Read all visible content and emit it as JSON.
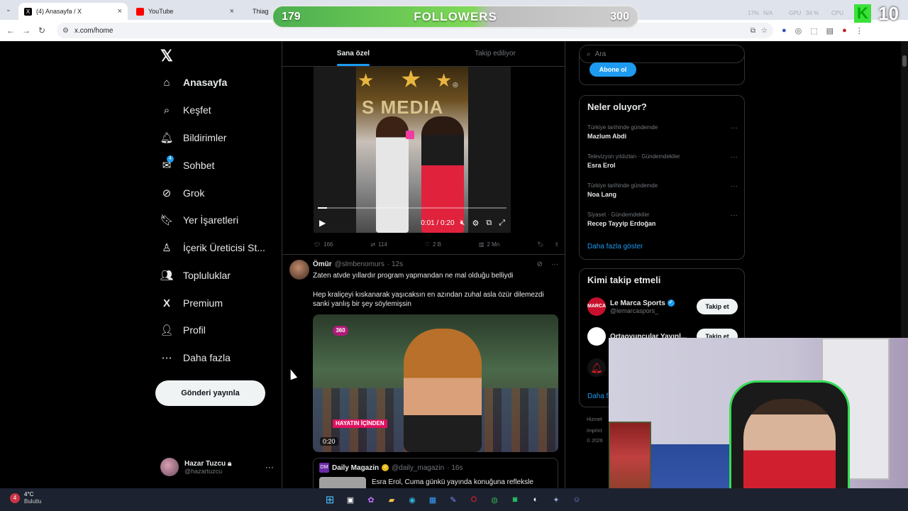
{
  "browser": {
    "tabs": [
      {
        "label": "(4) Anasayfa / X",
        "color": "#000000"
      },
      {
        "label": "YouTube",
        "color": "#ff0000"
      },
      {
        "label": "Thiag",
        "color": "#1a237e"
      }
    ],
    "url": "x.com/home"
  },
  "overlay": {
    "followers_label": "FOLLOWERS",
    "current": "179",
    "goal": "300",
    "progress_fraction": 0.597,
    "k_number": "10",
    "hw_stats": [
      "17%",
      "N/A",
      "GPU",
      "34 %",
      "CPU"
    ]
  },
  "sidebar": {
    "items": [
      {
        "label": "Anasayfa",
        "icon": "home-icon",
        "active": true
      },
      {
        "label": "Keşfet",
        "icon": "search-icon"
      },
      {
        "label": "Bildirimler",
        "icon": "bell-icon"
      },
      {
        "label": "Sohbet",
        "icon": "envelope-icon",
        "badge": "4"
      },
      {
        "label": "Grok",
        "icon": "grok-icon"
      },
      {
        "label": "Yer İşaretleri",
        "icon": "bookmark-icon"
      },
      {
        "label": "İçerik Üreticisi St...",
        "icon": "creator-icon"
      },
      {
        "label": "Topluluklar",
        "icon": "communities-icon"
      },
      {
        "label": "Premium",
        "icon": "x-premium-icon"
      },
      {
        "label": "Profil",
        "icon": "person-icon"
      },
      {
        "label": "Daha fazla",
        "icon": "more-circle-icon"
      }
    ],
    "post_button": "Gönderi yayınla",
    "account": {
      "name": "Hazar Tuzcu",
      "handle": "@hazartuzcu"
    }
  },
  "feed": {
    "tabs": [
      "Sana özel",
      "Takip ediliyor"
    ],
    "tweet1": {
      "video_time": "0:01 / 0:20",
      "video_progress_fraction": 0.05,
      "replies": "166",
      "retweets": "114",
      "likes": "2 B",
      "views": "2 Mn"
    },
    "tweet2": {
      "name": "Ömür",
      "handle": "@slmbenomurs",
      "time": "· 12s",
      "line1": "Zaten atvde yıllardır program yapmandan ne mal olduğu belliydi",
      "line2": "Hep kraliçeyi kıskanarak yaşıcaksın en azından zuhal asla özür dilemezdi",
      "line3": "sanki yanlış bir şey söylemişsin",
      "video_duration": "0:20",
      "badge_360": "360",
      "overlay_text": "HAYATIN İÇİNDEN"
    },
    "quote": {
      "name": "Daily Magazin",
      "handle": "@daily_magazin",
      "time": "· 16s",
      "text": "Esra Erol, Cuma günkü yayında konuğuna refleksle"
    }
  },
  "right": {
    "search_placeholder": "Ara",
    "subscribe": "Abone ol",
    "trends_title": "Neler oluyor?",
    "trends": [
      {
        "context": "Türkiye tarihinde gündemde",
        "title": "Mazlum Abdi"
      },
      {
        "context": "Televizyon yıldızları · Gündemdekiler",
        "title": "Esra Erol"
      },
      {
        "context": "Türkiye tarihinde gündemde",
        "title": "Noa Lang"
      },
      {
        "context": "Siyaset · Gündemdekiler",
        "title": "Recep Tayyip Erdoğan"
      }
    ],
    "show_more": "Daha fazla göster",
    "who_title": "Kimi takip etmeli",
    "who": [
      {
        "name": "Le Marca Sports",
        "handle": "@lemarcaspors_",
        "button": "Takip et"
      },
      {
        "name": "Ortaoyuncular Yayınl...",
        "handle": "",
        "button": "Takip et"
      }
    ],
    "who_more": "Daha f",
    "footer": [
      "Hizmet",
      "Imprint",
      "© 2026"
    ]
  },
  "taskbar": {
    "weather_temp": "4°C",
    "weather_desc": "Bulutlu",
    "weather_badge": "4"
  }
}
